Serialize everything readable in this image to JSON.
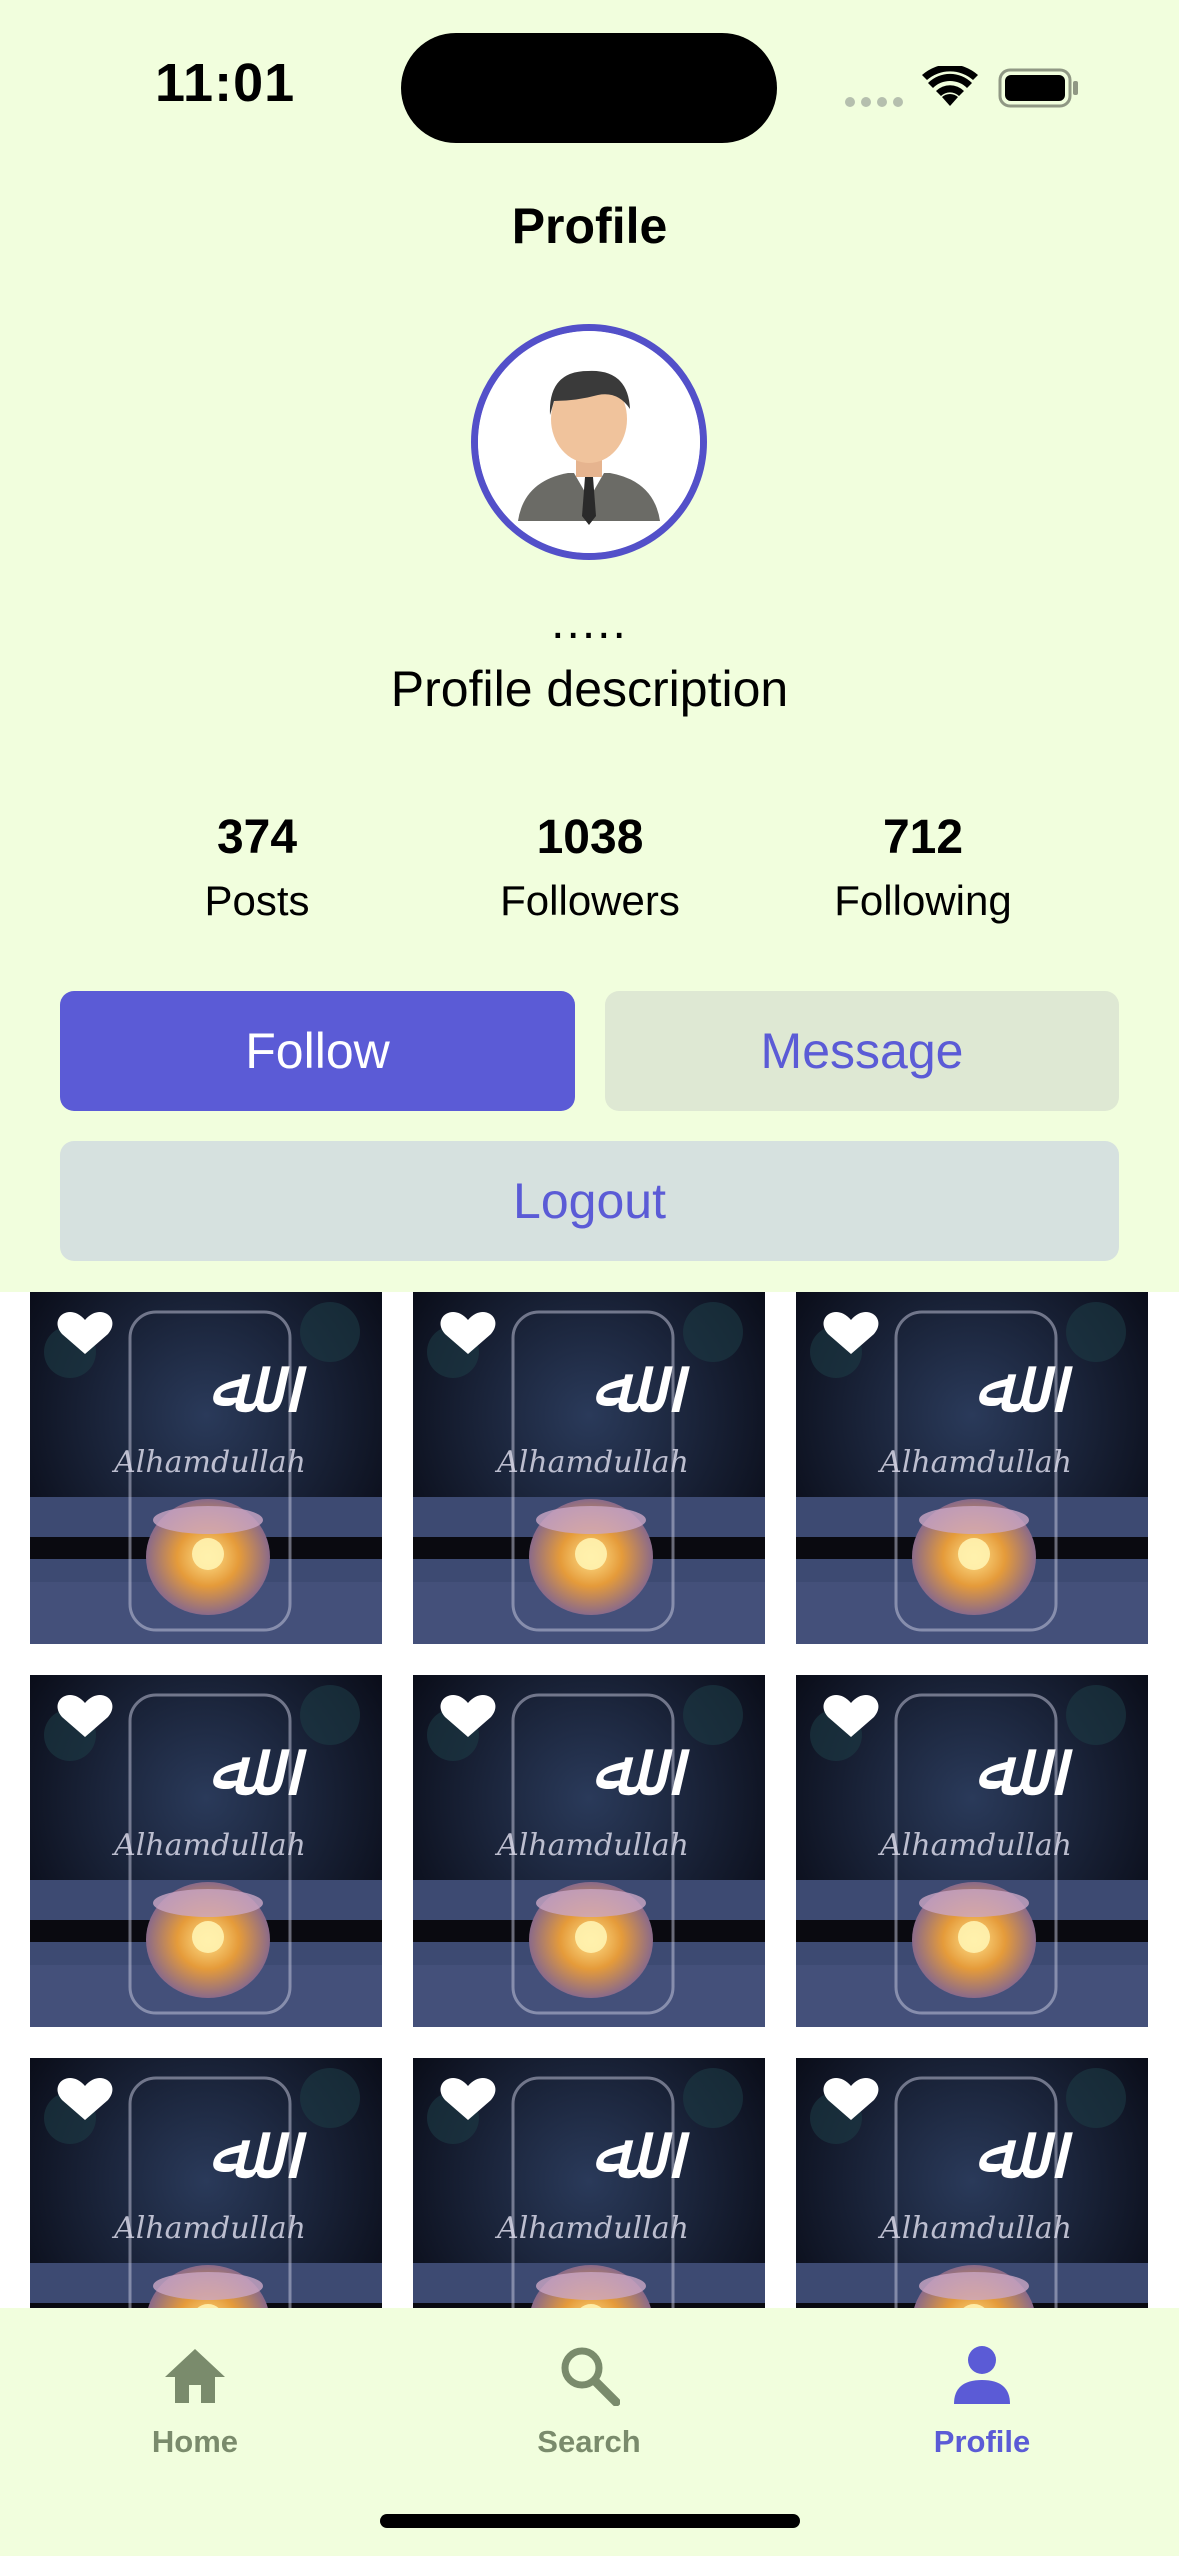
{
  "status_bar": {
    "time": "11:01"
  },
  "header": {
    "title": "Profile"
  },
  "profile": {
    "username": ".....",
    "description": "Profile description",
    "avatar_icon": "user-avatar-icon"
  },
  "stats": [
    {
      "value": "374",
      "label": "Posts"
    },
    {
      "value": "1038",
      "label": "Followers"
    },
    {
      "value": "712",
      "label": "Following"
    }
  ],
  "actions": {
    "follow": "Follow",
    "message": "Message",
    "logout": "Logout"
  },
  "grid": {
    "tile_text": "Alhamdullah",
    "tile_count": 9
  },
  "tabs": [
    {
      "label": "Home",
      "icon": "home-icon",
      "active": false
    },
    {
      "label": "Search",
      "icon": "search-icon",
      "active": false
    },
    {
      "label": "Profile",
      "icon": "person-icon",
      "active": true
    }
  ],
  "colors": {
    "background": "#f1fedd",
    "accent": "#5b5bd6",
    "inactive_tab": "#7a8b6c",
    "active_tab": "#5b5bd6"
  }
}
